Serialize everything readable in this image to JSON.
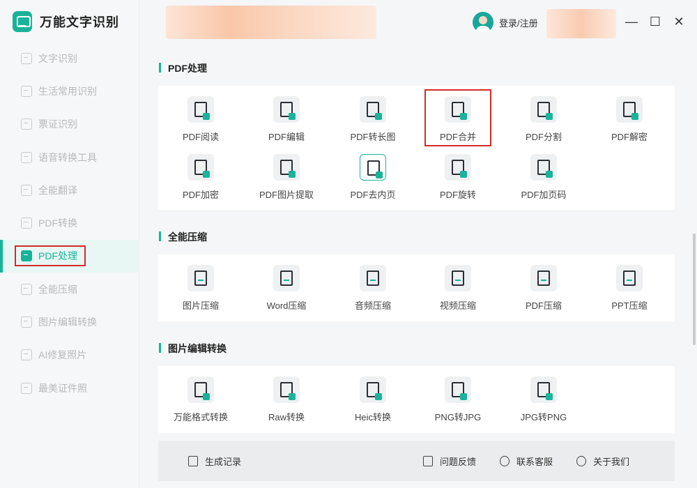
{
  "app": {
    "title": "万能文字识别"
  },
  "header": {
    "login_label": "登录/注册"
  },
  "sidebar": {
    "items": [
      {
        "label": "文字识别"
      },
      {
        "label": "生活常用识别"
      },
      {
        "label": "票证识别"
      },
      {
        "label": "语音转换工具"
      },
      {
        "label": "全能翻译"
      },
      {
        "label": "PDF转换"
      },
      {
        "label": "PDF处理",
        "active": true
      },
      {
        "label": "全能压缩"
      },
      {
        "label": "图片编辑转换"
      },
      {
        "label": "AI修复照片"
      },
      {
        "label": "最美证件照"
      }
    ]
  },
  "sections": [
    {
      "title": "PDF处理",
      "tools": [
        {
          "label": "PDF阅读"
        },
        {
          "label": "PDF编辑"
        },
        {
          "label": "PDF转长图"
        },
        {
          "label": "PDF合并"
        },
        {
          "label": "PDF分割"
        },
        {
          "label": "PDF解密"
        },
        {
          "label": "PDF加密"
        },
        {
          "label": "PDF图片提取"
        },
        {
          "label": "PDF去内页"
        },
        {
          "label": "PDF旋转"
        },
        {
          "label": "PDF加页码"
        }
      ]
    },
    {
      "title": "全能压缩",
      "tools": [
        {
          "label": "图片压缩"
        },
        {
          "label": "Word压缩"
        },
        {
          "label": "音频压缩"
        },
        {
          "label": "视频压缩"
        },
        {
          "label": "PDF压缩"
        },
        {
          "label": "PPT压缩"
        }
      ]
    },
    {
      "title": "图片编辑转换",
      "tools": [
        {
          "label": "万能格式转换"
        },
        {
          "label": "Raw转换"
        },
        {
          "label": "Heic转换"
        },
        {
          "label": "PNG转JPG"
        },
        {
          "label": "JPG转PNG"
        }
      ]
    }
  ],
  "footer": {
    "history_label": "生成记录",
    "feedback_label": "问题反馈",
    "service_label": "联系客服",
    "about_label": "关于我们"
  },
  "colors": {
    "accent": "#19b39a",
    "highlight_box": "#d22b2b"
  },
  "window_controls": {
    "minimize": "—",
    "maximize": "☐",
    "close": "✕"
  }
}
